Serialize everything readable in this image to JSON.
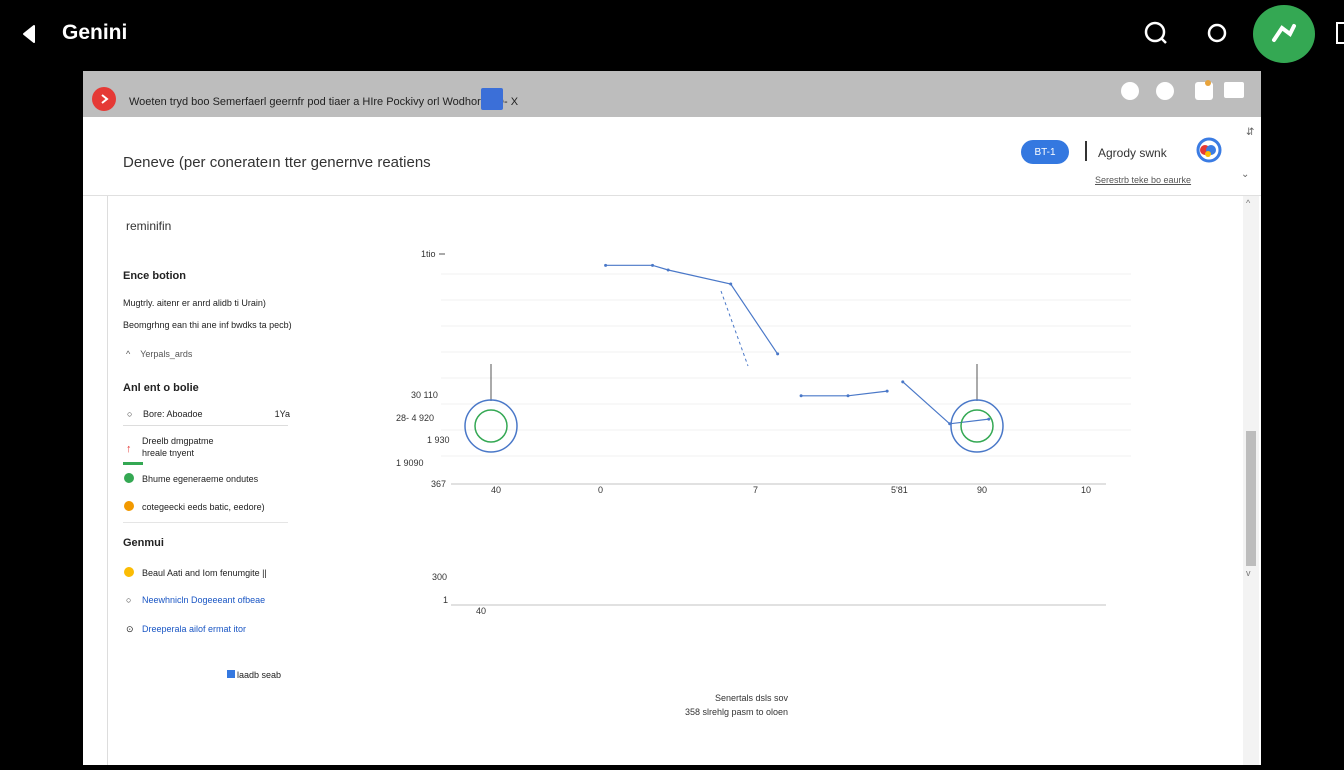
{
  "app": {
    "title": "Genini"
  },
  "window": {
    "title": "Woeten tryd boo Semerfaerl geernfr pod tiaer a HIre Pockivy orl Wodhoron D- X",
    "heading": "Deneve (per conerateın tter genernve reatiens",
    "pill_label": "BT-1",
    "header_label": "Agrody swnk",
    "header_sub": "Serestrb teke bo eaurke"
  },
  "sidebar": {
    "title": "reminifin",
    "section1": "Ence botion",
    "s1_line1": "Mugtrly. aitenr er anrd alidb ti Urain)",
    "s1_line2": "Beomgrhng ean thi ane inf bwdks ta pecb)",
    "s1_toggle": "Yerpals_ards",
    "section2": "Anl ent o bolie",
    "s2_input": "Bore: Aboadoe",
    "s2_input_value": "1Ya",
    "s2_item1a": "Dreelb dmgpatme",
    "s2_item1b": "hreale tnyent",
    "s2_item2": "Bhume egeneraeme ondutes",
    "s2_item3": "cotegeecki eeds batic, eedore)",
    "section3": "Genmui",
    "s3_item1": "Beaul Aati and Iom fenumgite ||",
    "s3_item2": "Neewhnicln Dogeeeant ofbeae",
    "s3_item3": "Dreeperala ailof ermat itor",
    "footer": "laadb seab"
  },
  "chart_data": {
    "type": "line",
    "title": "",
    "series": [
      {
        "name": "",
        "points": [
          [
            0.3,
            96
          ],
          [
            0.36,
            96
          ],
          [
            0.38,
            94
          ],
          [
            0.46,
            88
          ],
          [
            0.52,
            58
          ]
        ]
      },
      {
        "name": "",
        "points": [
          [
            0.55,
            40
          ],
          [
            0.61,
            40
          ],
          [
            0.66,
            42
          ]
        ]
      },
      {
        "name": "",
        "points": [
          [
            0.68,
            46
          ],
          [
            0.74,
            28
          ],
          [
            0.79,
            30
          ]
        ]
      }
    ],
    "y_ticks": [
      "1tio",
      "30 110",
      "28- 4 920",
      "1 930",
      "1 9090",
      "367"
    ],
    "x_ticks": [
      "40",
      "0",
      "7",
      "5'81",
      "90",
      "10"
    ],
    "lower_y_ticks": [
      "300",
      "1"
    ],
    "lower_x_tick": "40",
    "markers": [
      "start-ring",
      "end-ring"
    ]
  },
  "footer": {
    "line1": "Senertals dsls sov",
    "line2": "358 slrehlg pasm to oloen"
  },
  "colors": {
    "accent_blue": "#3478e0",
    "green": "#34a853",
    "red": "#e53935",
    "line_blue": "#4a78c8"
  }
}
